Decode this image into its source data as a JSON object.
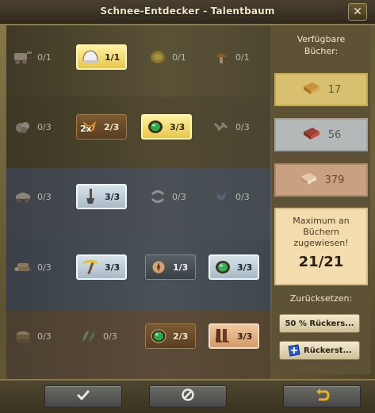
{
  "window": {
    "title": "Schnee-Entdecker  - Talentbaum",
    "close_icon": "close-icon"
  },
  "tree": {
    "rows": [
      [
        {
          "icon": "cart-icon",
          "count": "0/1",
          "state": "inactive"
        },
        {
          "icon": "helmet-icon",
          "count": "1/1",
          "state": "gold"
        },
        {
          "icon": "coin-icon",
          "count": "0/1",
          "state": "inactive"
        },
        {
          "icon": "mushroom-icon",
          "count": "0/1",
          "state": "inactive"
        }
      ],
      [
        {
          "icon": "ore-icon",
          "count": "0/3",
          "state": "inactive"
        },
        {
          "icon": "fox-icon",
          "count": "2/3",
          "state": "brown",
          "badge": "2x"
        },
        {
          "icon": "emerald-icon",
          "count": "3/3",
          "state": "gold"
        },
        {
          "icon": "bone-icon",
          "count": "0/3",
          "state": "inactive"
        }
      ],
      [
        {
          "icon": "wagon-icon",
          "count": "0/3",
          "state": "inactive"
        },
        {
          "icon": "shovel-icon",
          "count": "3/3",
          "state": "silver"
        },
        {
          "icon": "recycle-icon",
          "count": "0/3",
          "state": "inactive"
        },
        {
          "icon": "donkey-icon",
          "count": "0/3",
          "state": "inactive"
        }
      ],
      [
        {
          "icon": "logs-icon",
          "count": "0/3",
          "state": "inactive"
        },
        {
          "icon": "pickaxe-icon",
          "count": "3/3",
          "state": "silver"
        },
        {
          "icon": "compass-icon",
          "count": "1/3",
          "state": "dark"
        },
        {
          "icon": "gem-icon",
          "count": "3/3",
          "state": "silver"
        }
      ],
      [
        {
          "icon": "stump-icon",
          "count": "0/3",
          "state": "inactive"
        },
        {
          "icon": "leaves-icon",
          "count": "0/3",
          "state": "inactive"
        },
        {
          "icon": "emerald-icon",
          "count": "2/3",
          "state": "brown"
        },
        {
          "icon": "boots-icon",
          "count": "3/3",
          "state": "copper"
        }
      ]
    ]
  },
  "sidebar": {
    "available_label": "Verfügbare Bücher:",
    "books": [
      {
        "icon": "gold-book-icon",
        "value": "17"
      },
      {
        "icon": "silver-book-icon",
        "value": "56"
      },
      {
        "icon": "copper-book-icon",
        "value": "379"
      }
    ],
    "max_text": "Maximum an Büchern zugewiesen!",
    "max_value": "21/21",
    "reset_label": "Zurücksetzen:",
    "reset_50_label": "50 % Rückers...",
    "reset_full_label": "Rückerst..."
  },
  "footer": {
    "ok_icon": "checkmark-icon",
    "cancel_icon": "cancel-icon",
    "undo_icon": "undo-icon"
  },
  "colors": {
    "gold_bg": "#e8c64a",
    "silver_bg": "#a9bac6",
    "brown_bg": "#5a3e20",
    "copper_bg": "#d49a6a"
  }
}
